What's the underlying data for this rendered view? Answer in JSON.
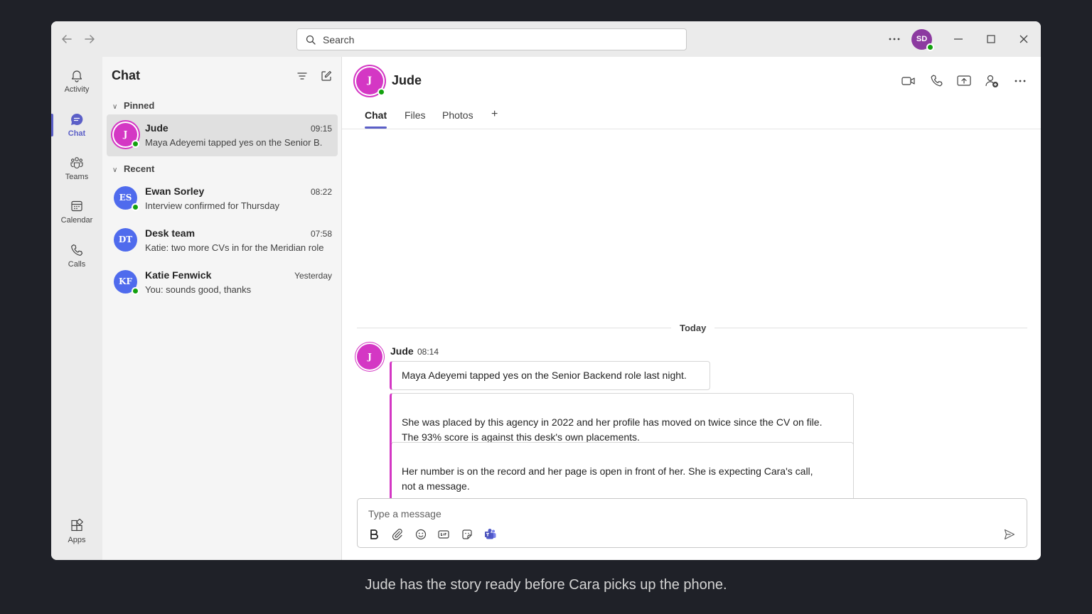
{
  "titlebar": {
    "search_placeholder": "Search",
    "me_initials": "SD",
    "me_color": "#8c3aa0"
  },
  "rail": {
    "items": [
      {
        "label": "Activity",
        "icon": "bell-icon"
      },
      {
        "label": "Chat",
        "icon": "chat-icon",
        "active": true
      },
      {
        "label": "Teams",
        "icon": "teams-icon"
      },
      {
        "label": "Calendar",
        "icon": "calendar-icon"
      },
      {
        "label": "Calls",
        "icon": "phone-icon"
      },
      {
        "label": "Apps",
        "icon": "apps-icon"
      }
    ]
  },
  "chatlist": {
    "title": "Chat",
    "pinned_label": "Pinned",
    "recent_label": "Recent",
    "pinned": [
      {
        "initials": "J",
        "name": "Jude",
        "time": "09:15",
        "preview": "Maya Adeyemi tapped yes on the Senior B.",
        "color": "#d437c4"
      }
    ],
    "recent": [
      {
        "initials": "ES",
        "name": "Ewan Sorley",
        "time": "08:22",
        "preview": "Interview confirmed for Thursday",
        "color": "#4f6bed"
      },
      {
        "initials": "DT",
        "name": "Desk team",
        "time": "07:58",
        "preview": "Katie: two more CVs in for the Meridian role",
        "color": "#4f6bed"
      },
      {
        "initials": "KF",
        "name": "Katie Fenwick",
        "time": "Yesterday",
        "preview": "You: sounds good, thanks",
        "color": "#4f6bed"
      }
    ]
  },
  "conversation": {
    "initials": "J",
    "name": "Jude",
    "accent": "#d437c4",
    "tabs": [
      "Chat",
      "Files",
      "Photos",
      "+"
    ],
    "day_label": "Today",
    "message": {
      "sender": "Jude",
      "time": "08:14",
      "bubbles": [
        "Maya Adeyemi tapped yes on the Senior Backend role last night.",
        "She was placed by this agency in 2022 and her profile has moved on twice since the CV on file.\nThe 93% score is against this desk's own placements.",
        "Her number is on the record and her page is open in front of her. She is expecting Cara's call,\nnot a message."
      ]
    },
    "composer_placeholder": "Type a message"
  },
  "caption": "Jude has the story ready before Cara picks up the phone."
}
